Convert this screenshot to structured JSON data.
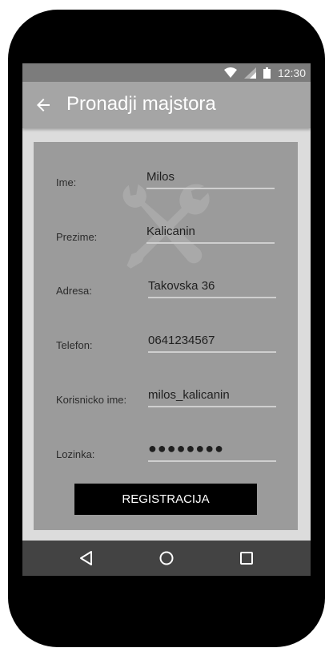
{
  "status": {
    "time": "12:30",
    "icons": [
      "wifi-icon",
      "signal-icon",
      "battery-icon"
    ]
  },
  "appbar": {
    "title": "Pronadji majstora",
    "back_icon": "arrow-left-icon"
  },
  "form": {
    "fields": [
      {
        "label": "Ime:",
        "value": "Milos"
      },
      {
        "label": "Prezime:",
        "value": "Kalicanin"
      },
      {
        "label": "Adresa:",
        "value": "Takovska 36"
      },
      {
        "label": "Telefon:",
        "value": "0641234567"
      },
      {
        "label": "Korisnicko ime:",
        "value": "milos_kalicanin"
      },
      {
        "label": "Lozinka:",
        "value": "●●●●●●●●"
      }
    ],
    "submit_label": "REGISTRACIJA",
    "watermark_icon": "tools-icon"
  },
  "navbar": {
    "icons": [
      "back-triangle-icon",
      "home-circle-icon",
      "recents-square-icon"
    ]
  },
  "colors": {
    "statusbar": "#7c7c7c",
    "appbar": "#a5a5a5",
    "card": "#9b9b9b",
    "button": "#000000",
    "navbar": "#434343"
  }
}
